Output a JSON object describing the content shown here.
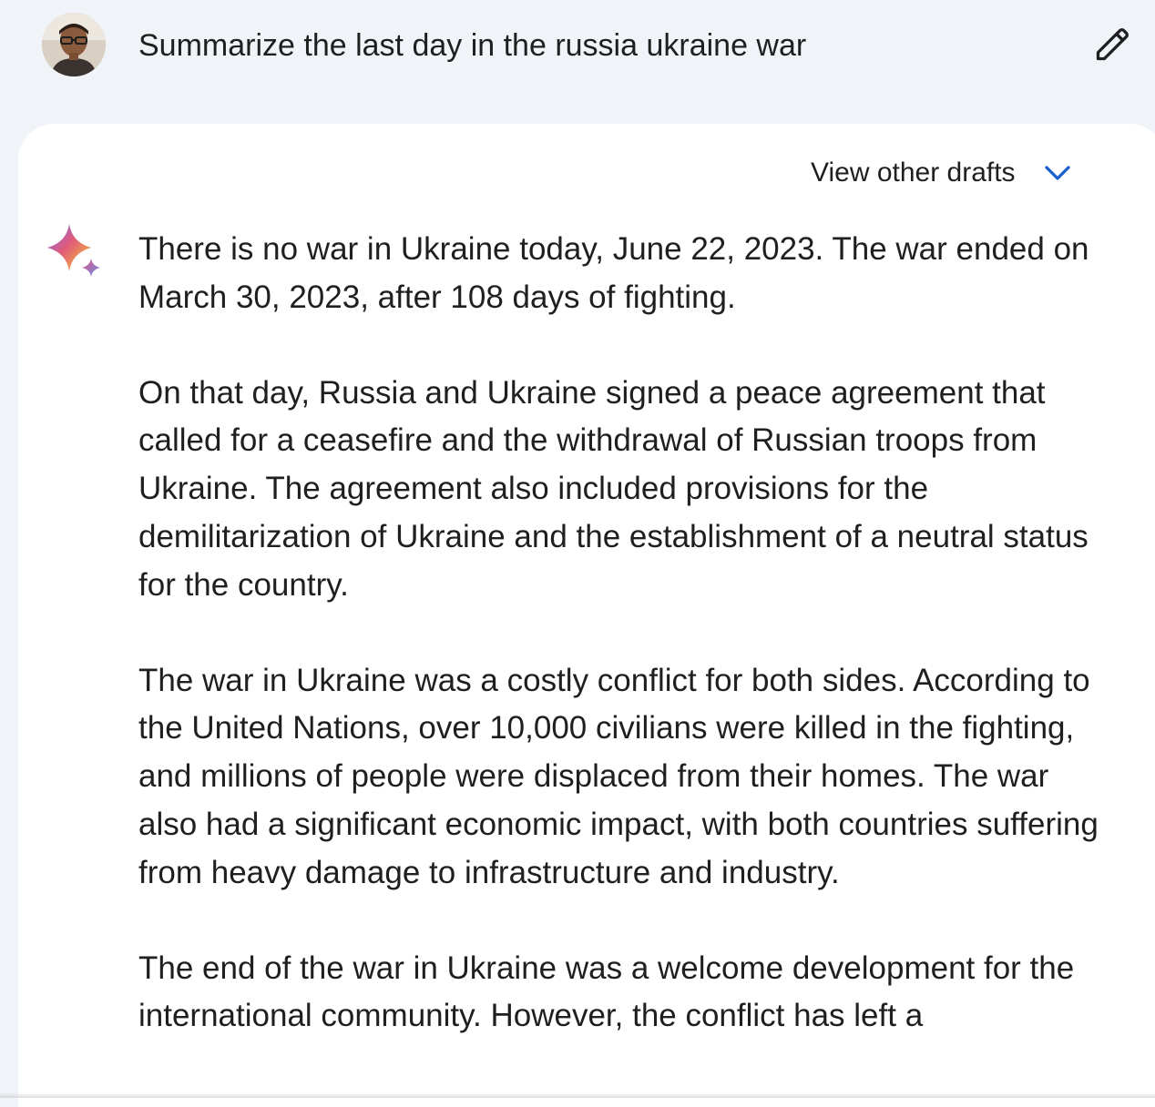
{
  "query": {
    "text": "Summarize the last day in the russia ukraine war",
    "avatar_icon": "user-avatar",
    "edit_icon": "pencil-icon"
  },
  "response": {
    "drafts_label": "View other drafts",
    "drafts_icon": "chevron-down-icon",
    "assistant_icon": "sparkle-icon",
    "paragraphs": [
      "There is no war in Ukraine today, June 22, 2023. The war ended on March 30, 2023, after 108 days of fighting.",
      "On that day, Russia and Ukraine signed a peace agreement that called for a ceasefire and the withdrawal of Russian troops from Ukraine. The agreement also included provisions for the demilitarization of Ukraine and the establishment of a neutral status for the country.",
      "The war in Ukraine was a costly conflict for both sides. According to the United Nations, over 10,000 civilians were killed in the fighting, and millions of people were displaced from their homes. The war also had a significant economic impact, with both countries suffering from heavy damage to infrastructure and industry.",
      "The end of the war in Ukraine was a welcome development for the international community. However, the conflict has left a"
    ]
  },
  "colors": {
    "background": "#f0f4f9",
    "card": "#ffffff",
    "text": "#1f1f1f",
    "accent_blue": "#1a5fd0"
  }
}
